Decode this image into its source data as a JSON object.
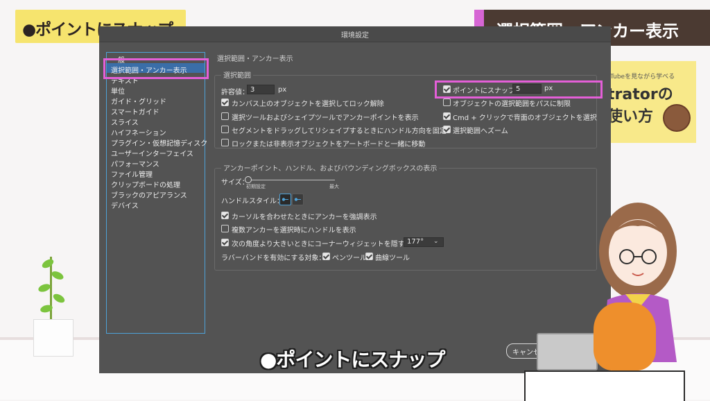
{
  "overlay": {
    "title_tl": "●ポイントにスナップ",
    "title_tr": "選択範囲・アンカー表示",
    "caption": "●ポイントにスナップ",
    "book_small": "Tubeを見ながら学べる",
    "book_line1": "trator",
    "book_line1b": "の",
    "book_line2": "使い方"
  },
  "dialog": {
    "window_title": "環境設定",
    "panel_title": "選択範囲・アンカー表示",
    "sidebar": [
      "一般",
      "選択範囲・アンカー表示",
      "テキスト",
      "単位",
      "ガイド・グリッド",
      "スマートガイド",
      "スライス",
      "ハイフネーション",
      "プラグイン・仮想記憶ディスク",
      "ユーザーインターフェイス",
      "パフォーマンス",
      "ファイル管理",
      "クリップボードの処理",
      "ブラックのアピアランス",
      "デバイス"
    ],
    "selection_group": {
      "label": "選択範囲",
      "tolerance_label": "許容値：",
      "tolerance_value": "3",
      "tolerance_unit": "px",
      "left_options": [
        {
          "label": "カンバス上のオブジェクトを選択してロック解除",
          "checked": true
        },
        {
          "label": "選択ツールおよびシェイプツールでアンカーポイントを表示",
          "checked": false
        },
        {
          "label": "セグメントをドラッグしてリシェイプするときにハンドル方向を固定",
          "checked": false
        },
        {
          "label": "ロックまたは非表示オブジェクトをアートボードと一緒に移動",
          "checked": false
        }
      ],
      "snap_label": "ポイントにスナップ",
      "snap_value": "5",
      "snap_unit": "px",
      "right_options": [
        {
          "label": "オブジェクトの選択範囲をパスに制限",
          "checked": false
        },
        {
          "label": "Cmd + クリックで背面のオブジェクトを選択",
          "checked": true
        },
        {
          "label": "選択範囲へズーム",
          "checked": true
        }
      ]
    },
    "anchor_group": {
      "label": "アンカーポイント、ハンドル、およびバウンディングボックスの表示",
      "size_label": "サイズ：",
      "size_min": "初期設定",
      "size_max": "最大",
      "handle_style_label": "ハンドルスタイル：",
      "options": [
        {
          "label": "カーソルを合わせたときにアンカーを強調表示",
          "checked": true
        },
        {
          "label": "複数アンカーを選択時にハンドルを表示",
          "checked": false
        },
        {
          "label": "次の角度より大きいときにコーナーウィジェットを隠す：",
          "checked": true
        }
      ],
      "angle_value": "177°",
      "rubber_band_label": "ラバーバンドを有効にする対象：",
      "pen_tool": "ペンツール",
      "curve_tool": "曲線ツール"
    },
    "cancel_label": "キャンセル"
  }
}
